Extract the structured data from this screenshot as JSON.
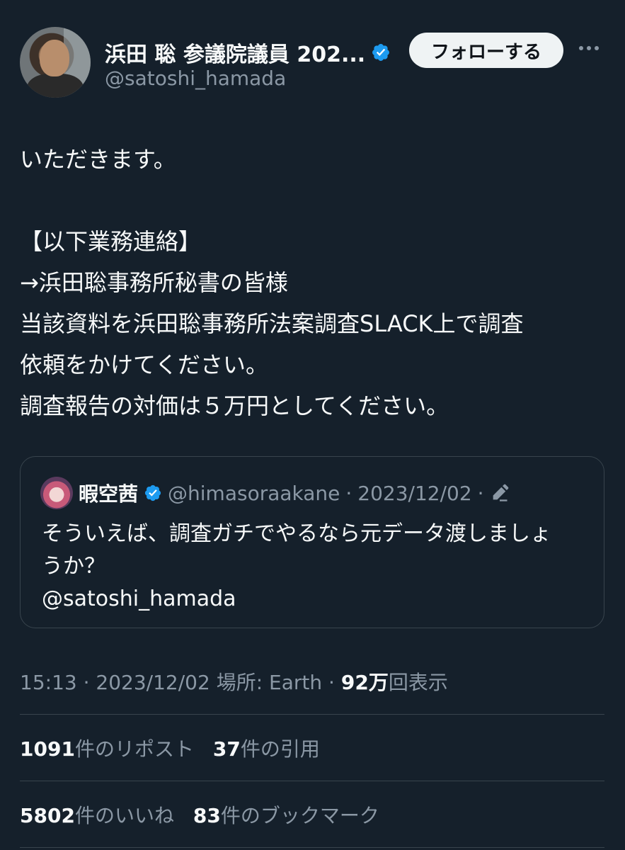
{
  "author": {
    "name": "浜田 聡 参議院議員 202...",
    "handle": "@satoshi_hamada",
    "follow_label": "フォローする"
  },
  "tweet": {
    "lines": [
      "いただきます。",
      "",
      "【以下業務連絡】",
      "→浜田聡事務所秘書の皆様",
      "当該資料を浜田聡事務所法案調査SLACK上で調査",
      "依頼をかけてください。",
      "調査報告の対価は５万円としてください。"
    ]
  },
  "quote": {
    "name": "暇空茜",
    "handle": "@himasoraakane",
    "separator": "·",
    "date": "2023/12/02",
    "lines": [
      "そういえば、調査ガチでやるなら元データ渡しましょ",
      "うか？",
      "@satoshi_hamada"
    ]
  },
  "meta": {
    "time": "15:13",
    "separator": "·",
    "date": "2023/12/02",
    "location": "場所: Earth",
    "views_num": "92万",
    "views_label": "回表示"
  },
  "stats": {
    "reposts_num": "1091",
    "reposts_label": "件のリポスト",
    "quotes_num": "37",
    "quotes_label": "件の引用",
    "likes_num": "5802",
    "likes_label": "件のいいね",
    "bookmarks_num": "83",
    "bookmarks_label": "件のブックマーク"
  },
  "colors": {
    "background": "#15202b",
    "text": "#f7f9f9",
    "secondary": "#8b98a5",
    "verified": "#1d9bf0",
    "border": "#38444d"
  }
}
